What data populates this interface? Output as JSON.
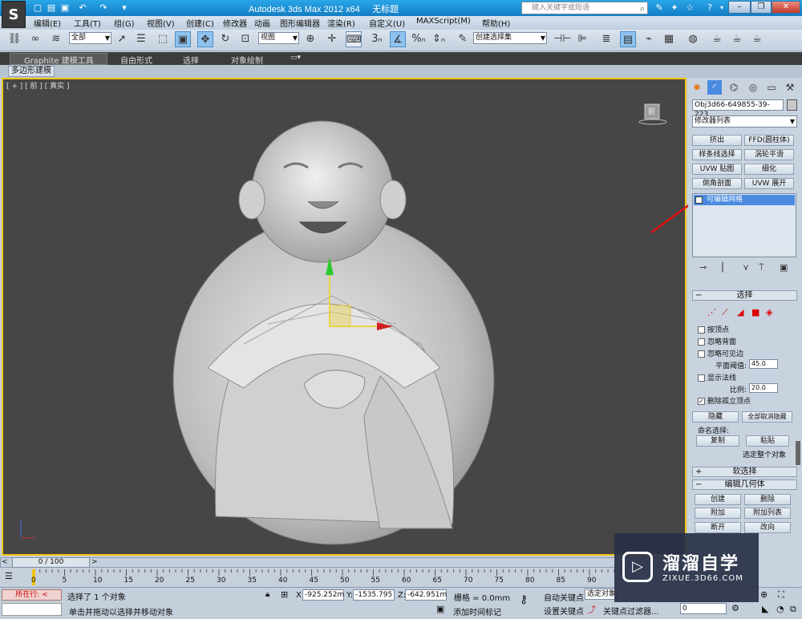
{
  "title": {
    "app": "Autodesk 3ds Max  2012 x64",
    "file": "无标题",
    "search_placeholder": "键入关键字或短语"
  },
  "menu": [
    "编辑(E)",
    "工具(T)",
    "组(G)",
    "视图(V)",
    "创建(C)",
    "修改器",
    "动画",
    "图形编辑器",
    "渲染(R)",
    "自定义(U)",
    "MAXScript(M)",
    "帮助(H)"
  ],
  "toolbar": {
    "selection_filter": "全部",
    "ref_coord": "视图",
    "snap_label": "3",
    "named_set": "创建选择集"
  },
  "ribbon": {
    "tabs": [
      "Graphite 建模工具",
      "自由形式",
      "选择",
      "对象绘制"
    ],
    "sub": "多边形建模"
  },
  "viewport": {
    "label": "[ + ] [ 前 ] [ 真实 ]",
    "viewcube": "前"
  },
  "command_panel": {
    "object_name": "Obj3d66-649855-39-223",
    "modifier_list": "修改器列表",
    "modifier_buttons": [
      "挤出",
      "FFD(圆柱体)",
      "样条线选择",
      "涡轮平滑",
      "UVW 贴图",
      "细化",
      "倒角剖面",
      "UVW 展开"
    ],
    "stack_item": "可编辑网格",
    "rollout_select": "选择",
    "check_vertex": "按顶点",
    "check_backface": "忽略背面",
    "check_visible": "忽略可见边",
    "plane_threshold_label": "平面阈值:",
    "plane_threshold": "45.0",
    "check_normals": "显示法线",
    "scale_label": "比例:",
    "scale": "20.0",
    "check_isolated": "删除孤立顶点",
    "btn_hide": "隐藏",
    "btn_unhide": "全部取消隐藏",
    "named_sel_label": "命名选择:",
    "btn_copy": "复制",
    "btn_paste": "粘贴",
    "select_whole": "选定整个对象",
    "rollout_soft": "软选择",
    "rollout_edit": "编辑几何体",
    "btn_create": "创建",
    "btn_delete": "删除",
    "btn_attach": "附加",
    "btn_attach_list": "附加列表",
    "btn_detach": "断开",
    "btn_turn": "改向"
  },
  "timeline": {
    "frame": "0 / 100",
    "ticks": [
      "0",
      "5",
      "10",
      "15",
      "20",
      "25",
      "30",
      "35",
      "40",
      "45",
      "50",
      "55",
      "60",
      "65",
      "70",
      "75",
      "80",
      "85",
      "90"
    ]
  },
  "status": {
    "running": "所在行:",
    "selected": "选择了 1 个对象",
    "prompt": "单击并拖动以选择并移动对象",
    "x_label": "X:",
    "x": "-925.252m",
    "y_label": "Y:",
    "y": "-1535.795",
    "z_label": "Z:",
    "z": "-642.951m",
    "grid": "栅格 = 0.0mm",
    "autokey": "自动关键点",
    "selected_obj": "选定对象",
    "setkey": "设置关键点",
    "key_filter": "关键点过滤器...",
    "add_tag": "添加时间标记",
    "frame_value": "0"
  },
  "watermark": {
    "main": "溜溜自学",
    "sub": "ZIXUE.3D66.COM"
  },
  "colors": {
    "accent_blue": "#1a8ad6",
    "highlight_red": "#e01010",
    "viewport_bg": "#464646"
  }
}
